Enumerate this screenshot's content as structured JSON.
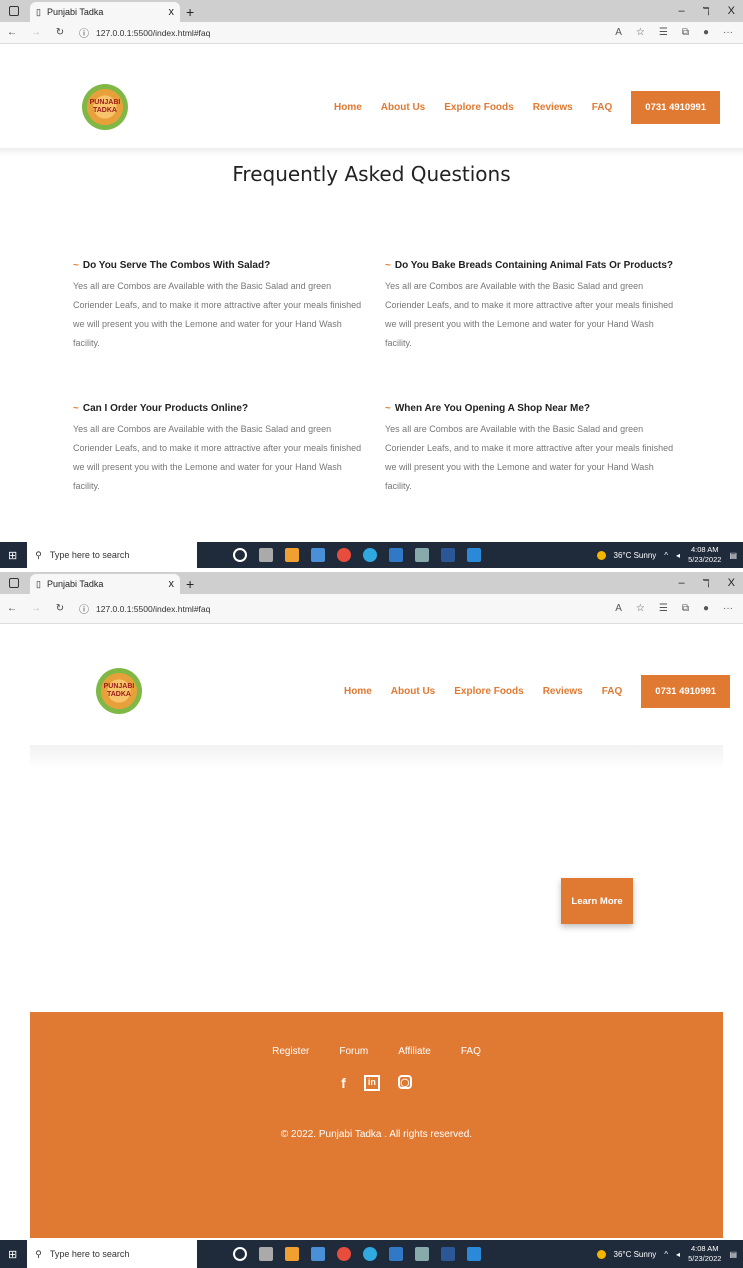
{
  "browser": {
    "tab_title": "Punjabi Tadka",
    "tab_close": "x",
    "new_tab": "+",
    "url": "127.0.0.1:5500/index.html#faq",
    "win_min": "–",
    "win_restore": "ℸ",
    "win_close": "X"
  },
  "site": {
    "logo_text": "PUNJABI TADKA",
    "nav": [
      "Home",
      "About Us",
      "Explore Foods",
      "Reviews",
      "FAQ"
    ],
    "phone": "0731 4910991",
    "faq_title": "Frequently Asked Questions",
    "faqs": [
      {
        "q": "Do You Serve The Combos With Salad?",
        "a": "Yes all are Combos are Available with the Basic Salad and green Coriender Leafs, and to make it more attractive after your meals finished we will present you with the Lemone and water for your Hand Wash facility."
      },
      {
        "q": "Do You Bake Breads Containing Animal Fats Or Products?",
        "a": "Yes all are Combos are Available with the Basic Salad and green Coriender Leafs, and to make it more attractive after your meals finished we will present you with the Lemone and water for your Hand Wash facility."
      },
      {
        "q": "Can I Order Your Products Online?",
        "a": "Yes all are Combos are Available with the Basic Salad and green Coriender Leafs, and to make it more attractive after your meals finished we will present you with the Lemone and water for your Hand Wash facility."
      },
      {
        "q": "When Are You Opening A Shop Near Me?",
        "a": "Yes all are Combos are Available with the Basic Salad and green Coriender Leafs, and to make it more attractive after your meals finished we will present you with the Lemone and water for your Hand Wash facility."
      }
    ],
    "faq_marker": "~",
    "learn_more": "Learn More",
    "footer_links": [
      "Register",
      "Forum",
      "Affiliate",
      "FAQ"
    ],
    "social_icons": [
      "facebook-icon",
      "linkedin-icon",
      "instagram-icon"
    ],
    "copyright": "© 2022. Punjabi Tadka . All rights reserved."
  },
  "taskbar": {
    "search_placeholder": "Type here to search",
    "weather": "36°C Sunny",
    "time": "4:08 AM",
    "date": "5/23/2022"
  },
  "colors": {
    "accent": "#e07a33",
    "taskbar": "#1f2a3a"
  }
}
